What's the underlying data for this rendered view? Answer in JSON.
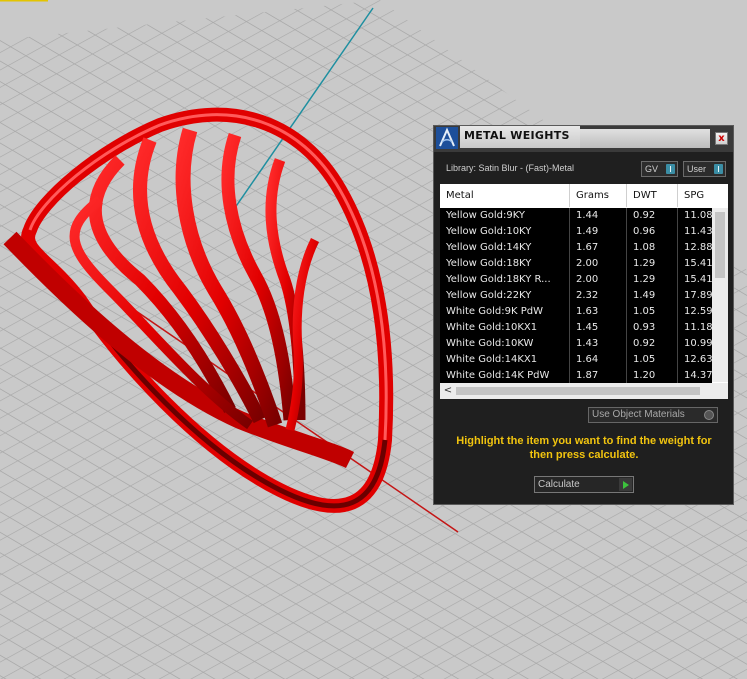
{
  "colors": {
    "viewport_bg": "#c9c9c9",
    "grid_line": "#a8a8a8",
    "axis_y": "#1e8fa0",
    "axis_x": "#c41616",
    "model": "#e00000",
    "panel_bg": "#1f1f1f",
    "instruction": "#f1c40f",
    "toggle_knob": "#3b8ea5"
  },
  "viewport": {
    "model_name": "red-ring-model-icon"
  },
  "panel": {
    "title": "METAL WEIGHTS",
    "close_label": "x",
    "library_label": "Library: Satin Blur - (Fast)-Metal",
    "gv_label": "GV",
    "user_label": "User",
    "use_materials_label": "Use Object Materials",
    "instruction": "Highlight the item you want to find the weight for then press calculate.",
    "calculate_label": "Calculate",
    "hscroll_left": "<"
  },
  "table": {
    "columns": [
      "Metal",
      "Grams",
      "DWT",
      "SPG"
    ],
    "rows": [
      [
        "Yellow Gold:9KY",
        "1.44",
        "0.92",
        "11.08"
      ],
      [
        "Yellow Gold:10KY",
        "1.49",
        "0.96",
        "11.43"
      ],
      [
        "Yellow Gold:14KY",
        "1.67",
        "1.08",
        "12.88"
      ],
      [
        "Yellow Gold:18KY",
        "2.00",
        "1.29",
        "15.41"
      ],
      [
        "Yellow Gold:18KY R...",
        "2.00",
        "1.29",
        "15.41"
      ],
      [
        "Yellow Gold:22KY",
        "2.32",
        "1.49",
        "17.89"
      ],
      [
        "White Gold:9K PdW",
        "1.63",
        "1.05",
        "12.59"
      ],
      [
        "White Gold:10KX1",
        "1.45",
        "0.93",
        "11.18"
      ],
      [
        "White Gold:10KW",
        "1.43",
        "0.92",
        "10.99"
      ],
      [
        "White Gold:14KX1",
        "1.64",
        "1.05",
        "12.63"
      ],
      [
        "White Gold:14K PdW",
        "1.87",
        "1.20",
        "14.37"
      ]
    ]
  }
}
